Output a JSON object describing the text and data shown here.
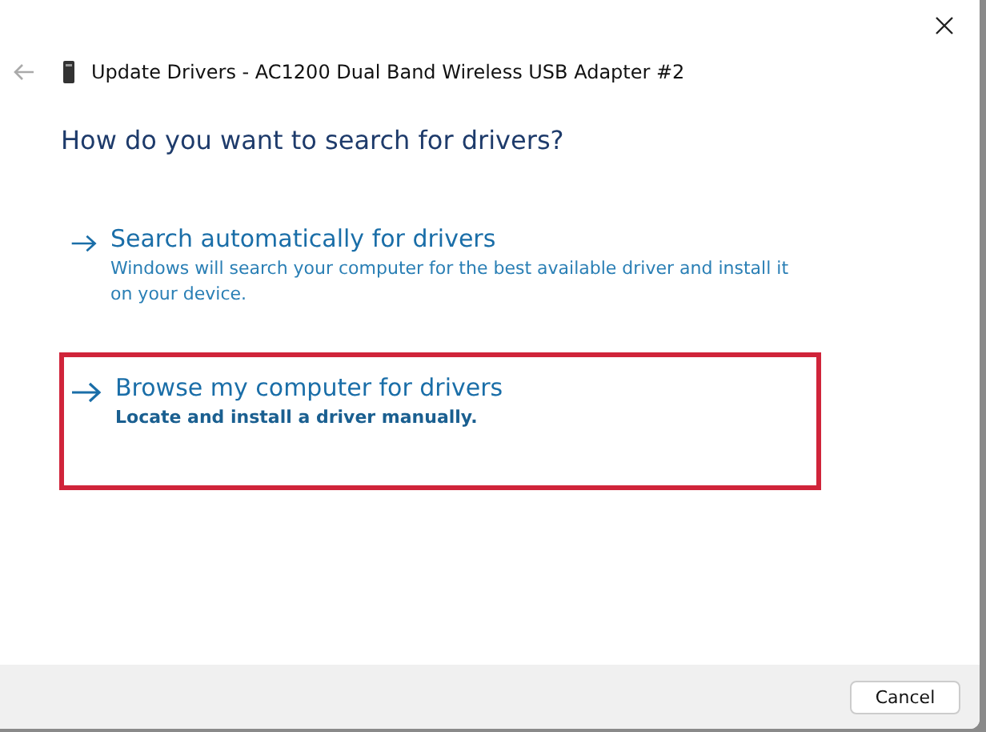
{
  "window": {
    "title": "Update Drivers - AC1200  Dual Band Wireless USB Adapter #2"
  },
  "heading": "How do you want to search for drivers?",
  "options": [
    {
      "title": "Search automatically for drivers",
      "description": "Windows will search your computer for the best available driver and install it on your device.",
      "highlighted": false
    },
    {
      "title": "Browse my computer for drivers",
      "description": "Locate and install a driver manually.",
      "highlighted": true
    }
  ],
  "buttons": [
    "Cancel"
  ]
}
